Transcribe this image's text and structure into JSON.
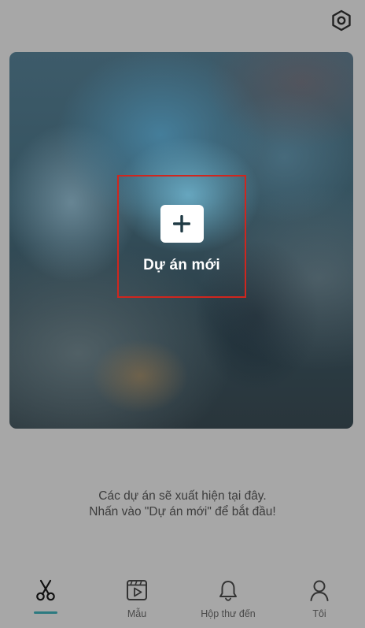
{
  "header": {
    "settings_icon": "settings-hexagon-icon"
  },
  "hero": {
    "new_project_label": "Dự án mới",
    "plus_icon": "plus-icon"
  },
  "empty_state": {
    "line1": "Các dự án sẽ xuất hiện tại đây.",
    "line2": "Nhấn vào \"Dự án mới\" để bắt đầu!"
  },
  "tabs": [
    {
      "label": "",
      "icon": "scissors-icon",
      "active": true
    },
    {
      "label": "Mẫu",
      "icon": "template-play-icon",
      "active": false
    },
    {
      "label": "Hộp thư đến",
      "icon": "bell-icon",
      "active": false
    },
    {
      "label": "Tôi",
      "icon": "user-icon",
      "active": false
    }
  ],
  "colors": {
    "highlight_border": "#d0261e",
    "active_indicator": "#2c7a80",
    "background": "#a7a7a7"
  }
}
